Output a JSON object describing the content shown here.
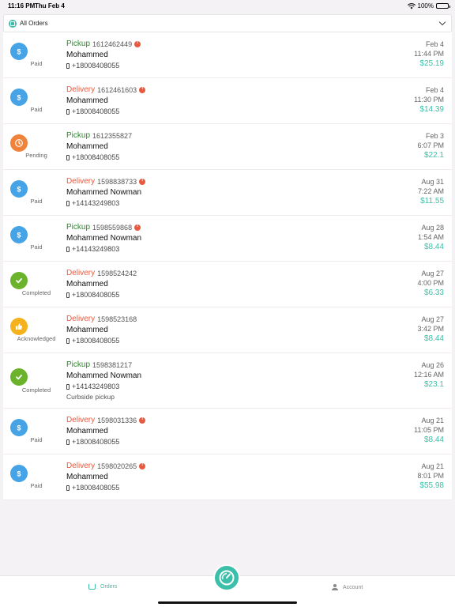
{
  "status_bar": {
    "time": "11:16 PM",
    "date": "Thu Feb 4",
    "battery": "100%"
  },
  "filter": {
    "label": "All Orders"
  },
  "colors": {
    "accent": "#3cbfa9",
    "pickup": "#2a8a2a",
    "delivery": "#e85a40",
    "paid": "#45a3e6",
    "pending": "#f0823a",
    "completed": "#6ab32b",
    "acknowledged": "#f5b21d"
  },
  "orders": [
    {
      "type": "Pickup",
      "number": "1612462449",
      "alert": true,
      "customer": "Mohammed",
      "phone": "+18008408055",
      "note": "",
      "date": "Feb 4",
      "time": "11:44 PM",
      "price": "$25.19",
      "status": "Paid",
      "status_icon": "dollar-icon"
    },
    {
      "type": "Delivery",
      "number": "1612461603",
      "alert": true,
      "customer": "Mohammed",
      "phone": "+18008408055",
      "note": "",
      "date": "Feb 4",
      "time": "11:30 PM",
      "price": "$14.39",
      "status": "Paid",
      "status_icon": "dollar-icon"
    },
    {
      "type": "Pickup",
      "number": "1612355827",
      "alert": false,
      "customer": "Mohammed",
      "phone": "+18008408055",
      "note": "",
      "date": "Feb 3",
      "time": "6:07 PM",
      "price": "$22.1",
      "status": "Pending",
      "status_icon": "clock-icon"
    },
    {
      "type": "Delivery",
      "number": "1598838733",
      "alert": true,
      "customer": "Mohammed Nowman",
      "phone": "+14143249803",
      "note": "",
      "date": "Aug 31",
      "time": "7:22 AM",
      "price": "$11.55",
      "status": "Paid",
      "status_icon": "dollar-icon"
    },
    {
      "type": "Pickup",
      "number": "1598559868",
      "alert": true,
      "customer": "Mohammed Nowman",
      "phone": "+14143249803",
      "note": "",
      "date": "Aug 28",
      "time": "1:54 AM",
      "price": "$8.44",
      "status": "Paid",
      "status_icon": "dollar-icon"
    },
    {
      "type": "Delivery",
      "number": "1598524242",
      "alert": false,
      "customer": "Mohammed",
      "phone": "+18008408055",
      "note": "",
      "date": "Aug 27",
      "time": "4:00 PM",
      "price": "$6.33",
      "status": "Completed",
      "status_icon": "checkmark-icon"
    },
    {
      "type": "Delivery",
      "number": "1598523168",
      "alert": false,
      "customer": "Mohammed",
      "phone": "+18008408055",
      "note": "",
      "date": "Aug 27",
      "time": "3:42 PM",
      "price": "$8.44",
      "status": "Acknowledged",
      "status_icon": "thumbs-up-icon"
    },
    {
      "type": "Pickup",
      "number": "1598381217",
      "alert": false,
      "customer": "Mohammed Nowman",
      "phone": "+14143249803",
      "note": "Curbside pickup",
      "date": "Aug 26",
      "time": "12:16 AM",
      "price": "$23.1",
      "status": "Completed",
      "status_icon": "checkmark-icon"
    },
    {
      "type": "Delivery",
      "number": "1598031336",
      "alert": true,
      "customer": "Mohammed",
      "phone": "+18008408055",
      "note": "",
      "date": "Aug 21",
      "time": "11:05 PM",
      "price": "$8.44",
      "status": "Paid",
      "status_icon": "dollar-icon"
    },
    {
      "type": "Delivery",
      "number": "1598020265",
      "alert": true,
      "customer": "Mohammed",
      "phone": "+18008408055",
      "note": "",
      "date": "Aug 21",
      "time": "8:01 PM",
      "price": "$55.98",
      "status": "Paid",
      "status_icon": "dollar-icon"
    }
  ],
  "tab_bar": {
    "orders_label": "Orders",
    "account_label": "Account"
  }
}
